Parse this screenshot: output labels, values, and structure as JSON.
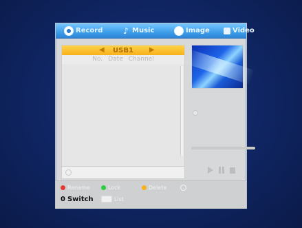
{
  "tabs": [
    {
      "label": "Record",
      "active": true
    },
    {
      "label": "Music",
      "active": false
    },
    {
      "label": "Image",
      "active": false
    },
    {
      "label": "Video",
      "active": false
    }
  ],
  "list": {
    "device": "USB1",
    "columns": [
      "No.",
      "Date",
      "Channel"
    ]
  },
  "player": {
    "progress_fraction": 0
  },
  "footer": {
    "red": "Rename",
    "green": "Lock",
    "yellow": "Delete",
    "switch": "Switch",
    "zero": "0",
    "list": "List"
  },
  "colors": {
    "background": "#0f2260",
    "panel": "#d7d8da",
    "tab_bar": "#3f9ee9",
    "usb_bar": "#f7b11a",
    "red": "#e53935",
    "green": "#2ecc40",
    "yellow": "#f7b11a"
  }
}
